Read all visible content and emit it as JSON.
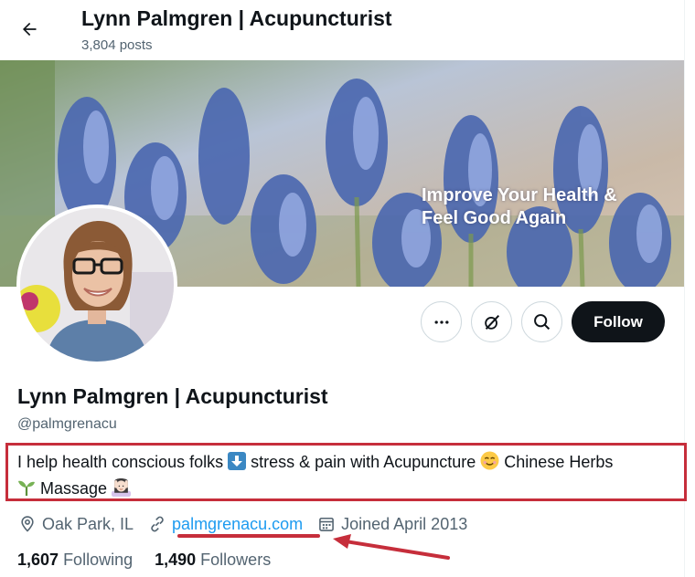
{
  "header": {
    "title": "Lynn Palmgren | Acupuncturist",
    "post_count": "3,804 posts"
  },
  "banner": {
    "headline_line1": "Improve Your Health &",
    "headline_line2": "Feel Good Again"
  },
  "actions": {
    "follow_label": "Follow"
  },
  "profile": {
    "display_name": "Lynn Palmgren | Acupuncturist",
    "handle": "@palmgrenacu",
    "bio_part1": "I help health conscious folks ",
    "bio_part2": " stress & pain with Acupuncture ",
    "bio_part3": " Chinese Herbs ",
    "bio_part4": " Massage ",
    "location": "Oak Park, IL",
    "website": "palmgrenacu.com",
    "joined": "Joined April 2013"
  },
  "stats": {
    "following_count": "1,607",
    "following_label": "Following",
    "followers_count": "1,490",
    "followers_label": "Followers"
  },
  "colors": {
    "annotation_red": "#c62e3b",
    "link_blue": "#1d9bf0",
    "follow_button": "#0f1419"
  }
}
